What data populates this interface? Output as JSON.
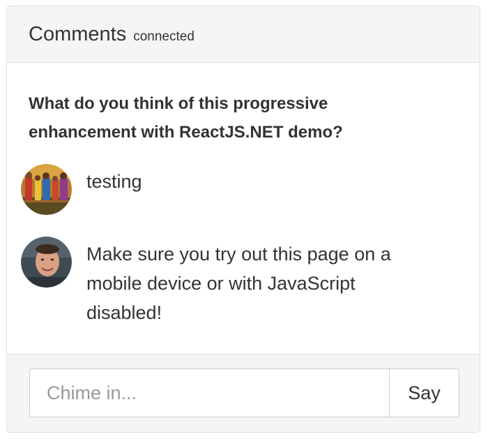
{
  "header": {
    "title": "Comments",
    "status": "connected"
  },
  "body": {
    "question": "What do you think of this progressive enhancement with ReactJS.NET demo?",
    "comments": [
      {
        "avatar_icon": "user-avatar-photo-group-icon",
        "text": "testing"
      },
      {
        "avatar_icon": "user-avatar-photo-man-icon",
        "text": "Make sure you try out this page on a mobile device or with JavaScript disabled!"
      }
    ]
  },
  "footer": {
    "input_value": "",
    "input_placeholder": "Chime in...",
    "submit_label": "Say"
  },
  "colors": {
    "panel_heading_bg": "#f5f5f5",
    "border": "#dddddd",
    "text": "#333333",
    "placeholder": "#999999"
  }
}
